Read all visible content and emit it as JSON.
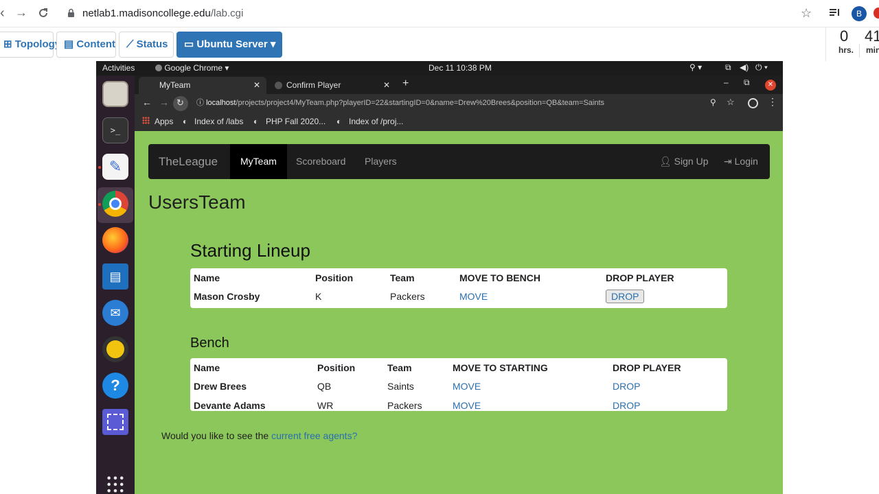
{
  "outer_browser": {
    "url_domain": "netlab1.madisoncollege.edu",
    "url_path": "/lab.cgi",
    "avatar_letter": "B"
  },
  "netlab": {
    "buttons": [
      {
        "label": "Topology",
        "icon": "sitemap-icon"
      },
      {
        "label": "Content",
        "icon": "book-icon"
      },
      {
        "label": "Status",
        "icon": "line-chart-icon"
      },
      {
        "label": "Ubuntu Server",
        "icon": "laptop-icon"
      }
    ],
    "timer": {
      "hours": "0",
      "minutes": "41",
      "hours_label": "hrs.",
      "minutes_label": "min"
    }
  },
  "gnome": {
    "activities": "Activities",
    "app_menu": "Google Chrome",
    "clock": "Dec 11  10:38 PM"
  },
  "inner_browser": {
    "tabs": [
      {
        "label": "MyTeam",
        "active": true
      },
      {
        "label": "Confirm Player",
        "active": false
      }
    ],
    "url_host": "localhost",
    "url_path": "/projects/project4/MyTeam.php?playerID=22&startingID=0&name=Drew%20Brees&position=QB&team=Saints",
    "bookmarks": [
      "Apps",
      "Index of /labs",
      "PHP Fall 2020...",
      "Index of /proj..."
    ]
  },
  "site": {
    "brand": "TheLeague",
    "nav": [
      "MyTeam",
      "Scoreboard",
      "Players"
    ],
    "active_nav": "MyTeam",
    "sign_up": "Sign Up",
    "login": "Login",
    "team_title": "UsersTeam",
    "starting": {
      "title": "Starting Lineup",
      "headers": [
        "Name",
        "Position",
        "Team",
        "MOVE TO BENCH",
        "DROP PLAYER"
      ],
      "rows": [
        {
          "name": "Mason Crosby",
          "position": "K",
          "team": "Packers",
          "move": "MOVE",
          "drop": "DROP"
        }
      ]
    },
    "bench": {
      "title": "Bench",
      "headers": [
        "Name",
        "Position",
        "Team",
        "MOVE TO STARTING",
        "DROP PLAYER"
      ],
      "rows": [
        {
          "name": "Drew Brees",
          "position": "QB",
          "team": "Saints",
          "move": "MOVE",
          "drop": "DROP"
        },
        {
          "name": "Devante Adams",
          "position": "WR",
          "team": "Packers",
          "move": "MOVE",
          "drop": "DROP"
        }
      ]
    },
    "free_agents_text": "Would you like to see the ",
    "free_agents_link": "current free agents?"
  },
  "colors": {
    "page_bg": "#8bc75a",
    "navbar_bg": "#1c1c1c",
    "link": "#2a6fb0",
    "netlab_primary": "#2f75b5"
  }
}
